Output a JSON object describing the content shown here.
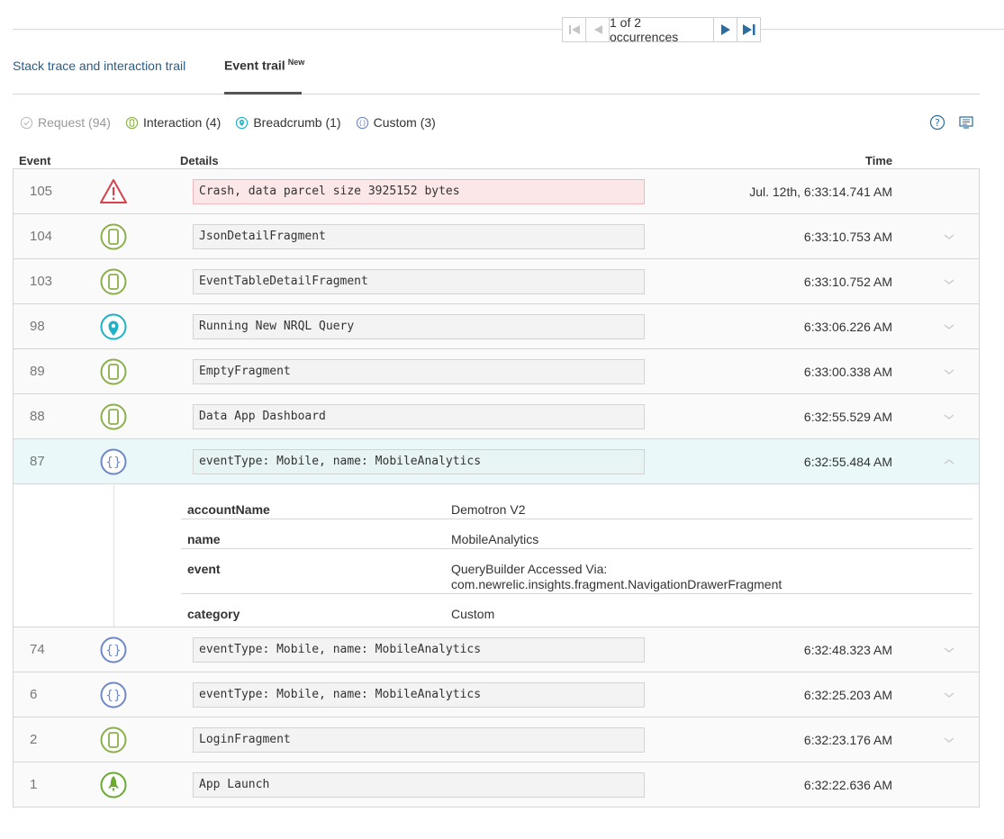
{
  "pager": {
    "text": "1 of 2 occurrences"
  },
  "tabs": [
    {
      "label": "Stack trace and interaction trail"
    },
    {
      "label": "Event trail",
      "badge": "New"
    }
  ],
  "filters": [
    {
      "label": "Request (94)",
      "icon": "check-circle-icon",
      "color": "#b9b9b9"
    },
    {
      "label": "Interaction (4)",
      "icon": "phone-icon",
      "color": "#8ab04a"
    },
    {
      "label": "Breadcrumb (1)",
      "icon": "pin-icon",
      "color": "#1fb1c6"
    },
    {
      "label": "Custom (3)",
      "icon": "braces-icon",
      "color": "#6f88c6"
    }
  ],
  "columns": {
    "event": "Event",
    "details": "Details",
    "time": "Time"
  },
  "rows": [
    {
      "num": "105",
      "type": "crash",
      "detail": "Crash, data parcel size 3925152 bytes",
      "time": "Jul. 12th, 6:33:14.741 AM"
    },
    {
      "num": "104",
      "type": "interaction",
      "detail": "JsonDetailFragment",
      "time": "6:33:10.753 AM"
    },
    {
      "num": "103",
      "type": "interaction",
      "detail": "EventTableDetailFragment",
      "time": "6:33:10.752 AM"
    },
    {
      "num": "98",
      "type": "breadcrumb",
      "detail": "Running New NRQL Query",
      "time": "6:33:06.226 AM"
    },
    {
      "num": "89",
      "type": "interaction",
      "detail": "EmptyFragment",
      "time": "6:33:00.338 AM"
    },
    {
      "num": "88",
      "type": "interaction",
      "detail": "Data App Dashboard",
      "time": "6:32:55.529 AM"
    },
    {
      "num": "87",
      "type": "custom",
      "detail": "eventType: Mobile, name: MobileAnalytics",
      "time": "6:32:55.484 AM",
      "expanded": true
    },
    {
      "num": "74",
      "type": "custom",
      "detail": "eventType: Mobile, name: MobileAnalytics",
      "time": "6:32:48.323 AM"
    },
    {
      "num": "6",
      "type": "custom",
      "detail": "eventType: Mobile, name: MobileAnalytics",
      "time": "6:32:25.203 AM"
    },
    {
      "num": "2",
      "type": "interaction",
      "detail": "LoginFragment",
      "time": "6:32:23.176 AM"
    },
    {
      "num": "1",
      "type": "launch",
      "detail": "App Launch",
      "time": "6:32:22.636 AM"
    }
  ],
  "expanded_attributes": [
    {
      "key": "accountName",
      "value": "Demotron V2"
    },
    {
      "key": "name",
      "value": "MobileAnalytics"
    },
    {
      "key": "event",
      "value_line1": "QueryBuilder Accessed Via:",
      "value_line2": "com.newrelic.insights.fragment.NavigationDrawerFragment"
    },
    {
      "key": "category",
      "value": "Custom"
    }
  ]
}
